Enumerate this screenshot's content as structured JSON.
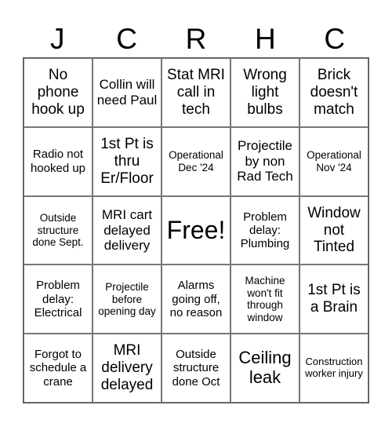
{
  "header": {
    "letters": [
      "J",
      "C",
      "R",
      "H",
      "C"
    ]
  },
  "cells": [
    {
      "text": "No phone hook up",
      "size": "m"
    },
    {
      "text": "Collin will need Paul",
      "size": "ms"
    },
    {
      "text": "Stat MRI call in tech",
      "size": "m"
    },
    {
      "text": "Wrong light bulbs",
      "size": "m"
    },
    {
      "text": "Brick doesn't match",
      "size": "m"
    },
    {
      "text": "Radio not hooked up",
      "size": "s"
    },
    {
      "text": "1st Pt is thru Er/Floor",
      "size": "m"
    },
    {
      "text": "Operational Dec '24",
      "size": "xs"
    },
    {
      "text": "Projectile by non Rad Tech",
      "size": "ms"
    },
    {
      "text": "Operational Nov '24",
      "size": "xs"
    },
    {
      "text": "Outside structure done Sept.",
      "size": "xs"
    },
    {
      "text": "MRI cart delayed delivery",
      "size": "ms"
    },
    {
      "text": "Free!",
      "size": "xl"
    },
    {
      "text": "Problem delay: Plumbing",
      "size": "s"
    },
    {
      "text": "Window not Tinted",
      "size": "m"
    },
    {
      "text": "Problem delay: Electrical",
      "size": "s"
    },
    {
      "text": "Projectile before opening day",
      "size": "xs"
    },
    {
      "text": "Alarms going off, no reason",
      "size": "s"
    },
    {
      "text": "Machine won't fit through window",
      "size": "xs"
    },
    {
      "text": "1st Pt is a Brain",
      "size": "m"
    },
    {
      "text": "Forgot to schedule a crane",
      "size": "s"
    },
    {
      "text": "MRI delivery delayed",
      "size": "m"
    },
    {
      "text": "Outside structure done Oct",
      "size": "s"
    },
    {
      "text": "Ceiling leak",
      "size": "l"
    },
    {
      "text": "Construction worker injury",
      "size": "xxs"
    }
  ]
}
